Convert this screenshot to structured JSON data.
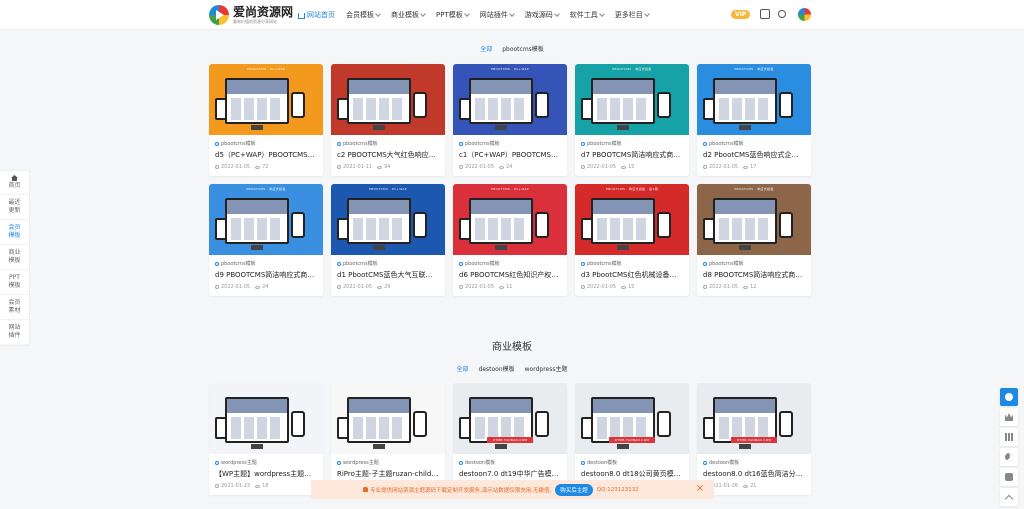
{
  "site": {
    "name": "爱尚资源网",
    "slogan": "最有价值的资源分享网站"
  },
  "nav": [
    {
      "label": "网站首页",
      "active": true,
      "caret": false
    },
    {
      "label": "会员模板",
      "caret": true
    },
    {
      "label": "商业模板",
      "caret": true
    },
    {
      "label": "PPT模板",
      "caret": true
    },
    {
      "label": "网站插件",
      "caret": true
    },
    {
      "label": "游戏源码",
      "caret": true
    },
    {
      "label": "软件工具",
      "caret": true
    },
    {
      "label": "更多栏目",
      "caret": true
    }
  ],
  "header": {
    "vip_label": "VIP"
  },
  "sidebar": [
    {
      "label": "首页",
      "icon": "home-icon"
    },
    {
      "label": "最近更新"
    },
    {
      "label": "会员模板",
      "active": true
    },
    {
      "label": "商业模板"
    },
    {
      "label": "PPT模板"
    },
    {
      "label": "会员素材"
    },
    {
      "label": "网站插件"
    }
  ],
  "section1": {
    "tabs": [
      "全部",
      "pbootcms模板"
    ],
    "cards": [
      {
        "tag": "pbootcms模板",
        "title": "d5（PC+WAP）PBOOTCMS简...",
        "date": "2022-01-05",
        "views": "72",
        "color": "#f39a1e",
        "banner": "PBOOTCMS · PC+WAP"
      },
      {
        "tag": "pbootcms模板",
        "title": "c2 PBOOTCMS大气红色响应式火...",
        "date": "2022-01-11",
        "views": "94",
        "color": "#c0392b",
        "banner": ""
      },
      {
        "tag": "pbootcms模板",
        "title": "c1（PC+WAP）PBOOTCMS蓝...",
        "date": "2022-01-05",
        "views": "24",
        "color": "#3554b8",
        "banner": "PBOOTCMS · PC+WAP"
      },
      {
        "tag": "pbootcms模板",
        "title": "d7 PBOOTCMS简洁响应式商城个...",
        "date": "2022-01-05",
        "views": "15",
        "color": "#17a2a8",
        "banner": "PBOOTCMS · 响应式模板"
      },
      {
        "tag": "pbootcms模板",
        "title": "d2 PbootCMS蓝色响应式企业官...",
        "date": "2022-01-05",
        "views": "17",
        "color": "#2b8de0",
        "banner": "PBOOTCMS · 响应式模板"
      },
      {
        "tag": "pbootcms模板",
        "title": "d9 PBOOTCMS简洁响应式商城个...",
        "date": "2022-01-05",
        "views": "24",
        "color": "#3b8fe0",
        "banner": "PBOOTCMS · 响应式模板"
      },
      {
        "tag": "pbootcms模板",
        "title": "d1 PbootCMS蓝色大气互联网工...",
        "date": "2022-01-05",
        "views": "29",
        "color": "#1c57b0",
        "banner": "PBOOTCMS · PC+WAP"
      },
      {
        "tag": "pbootcms模板",
        "title": "d6 PBOOTCMS红色知识产权商标...",
        "date": "2022-01-05",
        "views": "11",
        "color": "#d9303c",
        "banner": "PBOOTCMS · PC+WAP"
      },
      {
        "tag": "pbootcms模板",
        "title": "d3 PbootCMS红色机械设备企业...",
        "date": "2022-01-05",
        "views": "15",
        "color": "#d42a2a",
        "banner": "PBOOTCMS · 响应式模板 · 第1期"
      },
      {
        "tag": "pbootcms模板",
        "title": "d8 PBOOTCMS简洁响应式商城个...",
        "date": "2022-01-05",
        "views": "12",
        "color": "#8d6548",
        "banner": "PBOOTCMS · 响应式模板"
      }
    ]
  },
  "section2": {
    "title": "商业模板",
    "tabs": [
      "全部",
      "destoon模板",
      "wordpress主题"
    ],
    "cards": [
      {
        "tag": "wordpress主题",
        "title": "【WP主题】wordpress主题模板...",
        "date": "2021-01-23",
        "views": "18",
        "color": "#f2f4f8"
      },
      {
        "tag": "wordpress主题",
        "title": "RiPro主题-子主题ruzan-child美...",
        "date": "2021-01-23",
        "views": "33",
        "color": "#f7f7f7"
      },
      {
        "tag": "destoon模板",
        "title": "destoon7.0 dt19中华广告模板...",
        "date": "2021-01-26",
        "views": "21",
        "color": "#e9ecef",
        "banner": "DTMB.TAOBAO.COM"
      },
      {
        "tag": "destoon模板",
        "title": "destoon8.0 dt18公司黄页模板...",
        "date": "2021-01-26",
        "views": "22",
        "color": "#e9ecef",
        "banner": "DTMB.TAOBAO.COM"
      },
      {
        "tag": "destoon模板",
        "title": "destoon8.0 dt16蓝色简洁分类信...",
        "date": "2021-01-26",
        "views": "21",
        "color": "#e9ecef",
        "banner": "DTMB.TAOBAO.COM"
      }
    ]
  },
  "notice": {
    "text": "专业提供网站资源主题源码下载定制开发服务,演示站数据仅限充用,无缴值,",
    "button": "购买后主题",
    "contact": "QQ:123123132"
  },
  "right_toolbar": [
    "eye-icon",
    "crown-icon",
    "qrcode-icon",
    "moon-icon",
    "chat-icon",
    "back-to-top-icon"
  ]
}
